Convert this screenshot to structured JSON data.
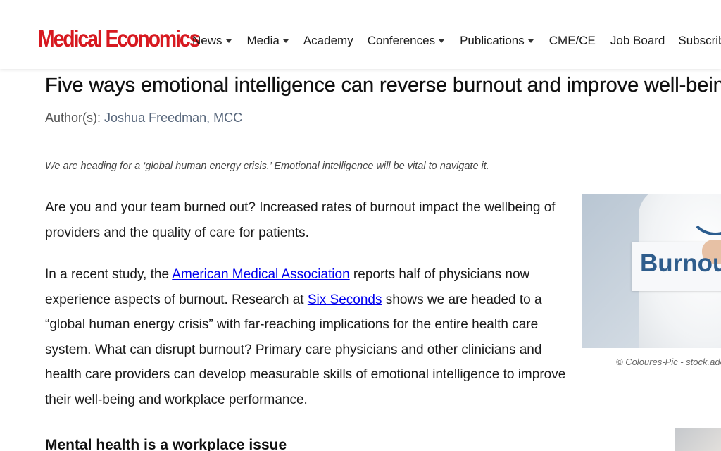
{
  "brand": {
    "logo_text": "Medical Economics",
    "accent_color": "#d71920"
  },
  "nav": {
    "items": [
      {
        "label": "News",
        "dropdown": true
      },
      {
        "label": "Media",
        "dropdown": true
      },
      {
        "label": "Academy",
        "dropdown": false
      },
      {
        "label": "Conferences",
        "dropdown": true
      },
      {
        "label": "Publications",
        "dropdown": true
      },
      {
        "label": "CME/CE",
        "dropdown": false
      },
      {
        "label": "Job Board",
        "dropdown": false
      },
      {
        "label": "Subscribe",
        "dropdown": false
      }
    ],
    "dropdown_icon": "caret-down-icon"
  },
  "article": {
    "title": "Five ways emotional intelligence can reverse burnout and improve well-being",
    "author_prefix": "Author(s):",
    "author_name": "Joshua Freedman, MCC",
    "deck": "We are heading for a ‘global human energy crisis.’ Emotional intelligence will be vital to navigate it.",
    "p1": "Are you and your team burned out? Increased rates of burnout impact the wellbeing of providers and the quality of care for patients.",
    "p2_a": "In a recent study, the ",
    "p2_link1": "American Medical Association",
    "p2_b": " reports half of physicians now experience aspects of burnout. Research at ",
    "p2_link2": "Six Seconds",
    "p2_c": " shows we are headed to a “global human energy crisis” with far-reaching implications for the entire health care system. What can disrupt burnout? Primary care physicians and other clinicians and health care providers can develop measurable skills of emotional intelligence to improve their well-being and workplace performance.",
    "subhead": "Mental health is a workplace issue"
  },
  "figure": {
    "sign_text": "Burnout",
    "caption": "© Coloures-Pic - stock.adobe.com"
  },
  "colors": {
    "link": "#0000ee",
    "author_link": "#56657a",
    "sign_text": "#2f5d8c"
  }
}
